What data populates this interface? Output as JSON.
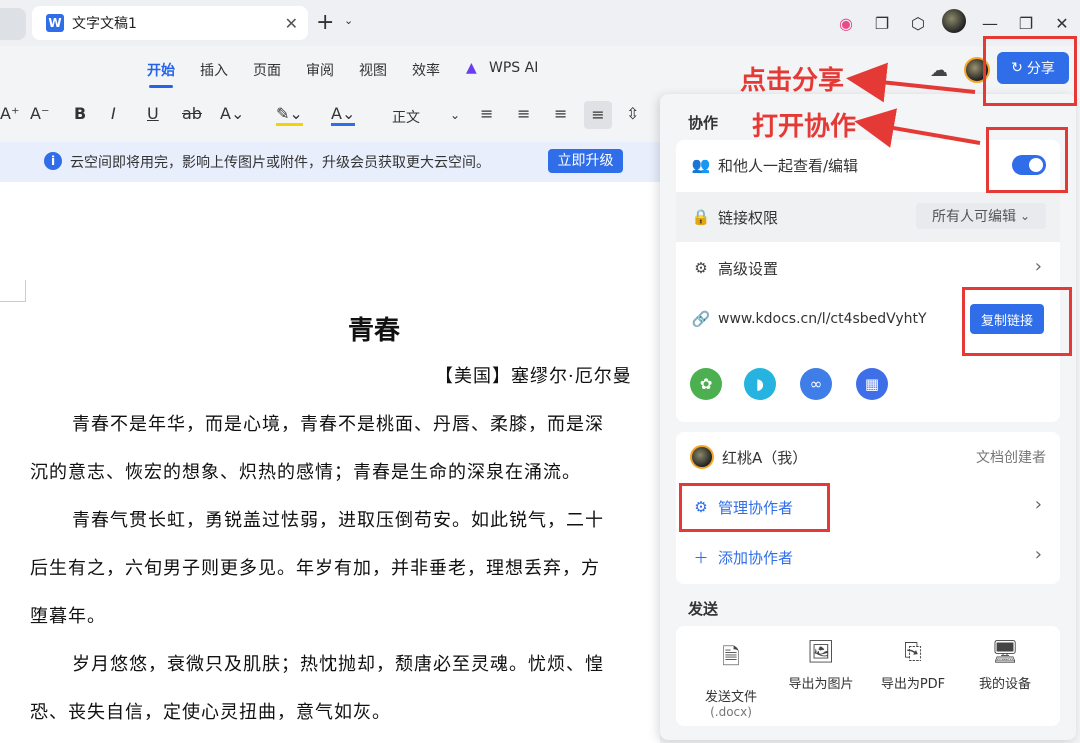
{
  "tab": {
    "title": "文字文稿1"
  },
  "menu": [
    "开始",
    "插入",
    "页面",
    "审阅",
    "视图",
    "效率",
    "WPS AI"
  ],
  "share_label": "分享",
  "annotations": {
    "click_share": "点击分享",
    "open_collab": "打开协作"
  },
  "toolbar": {
    "style_label": "正文"
  },
  "banner": {
    "text": "云空间即将用完，影响上传图片或附件，升级会员获取更大云空间。",
    "button": "立即升级"
  },
  "doc": {
    "title": "青春",
    "author": "【美国】塞缪尔·厄尔曼",
    "lines": [
      "青春不是年华，而是心境，青春不是桃面、丹唇、柔膝，而是深",
      "沉的意志、恢宏的想象、炽热的感情；青春是生命的深泉在涌流。",
      "青春气贯长虹，勇锐盖过怯弱，进取压倒苟安。如此锐气，二十",
      "后生有之，六旬男子则更多见。年岁有加，并非垂老，理想丢弃，方",
      "堕暮年。",
      "岁月悠悠，衰微只及肌肤；热忱抛却，颓唐必至灵魂。忧烦、惶",
      "恐、丧失自信，定使心灵扭曲，意气如灰。"
    ]
  },
  "panel": {
    "collab_title": "协作",
    "share_edit": "和他人一起查看/编辑",
    "link_perm_label": "链接权限",
    "link_perm_value": "所有人可编辑",
    "advanced": "高级设置",
    "link_url": "www.kdocs.cn/l/ct4sbedVyhtY",
    "copy_link": "复制链接",
    "owner_name": "红桃A（我）",
    "owner_role": "文档创建者",
    "manage_collab": "管理协作者",
    "add_collab": "添加协作者",
    "send_title": "发送",
    "send_items": [
      "发送文件",
      "导出为图片",
      "导出为PDF",
      "我的设备"
    ],
    "send_file_sub": "(.docx)"
  },
  "colors": {
    "accent": "#2f6ee8",
    "annotation": "#e53935"
  }
}
